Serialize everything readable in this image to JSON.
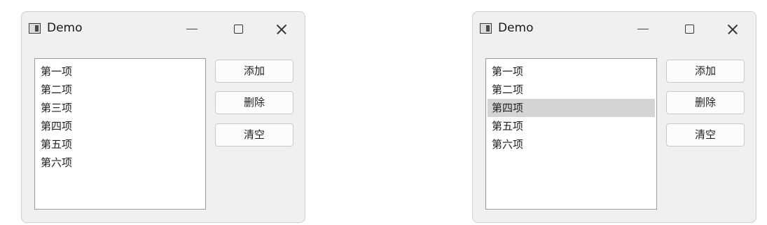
{
  "windows": [
    {
      "title": "Demo",
      "items": [
        "第一项",
        "第二项",
        "第三项",
        "第四项",
        "第五项",
        "第六项"
      ],
      "buttons": {
        "add": "添加",
        "delete": "删除",
        "clear": "清空"
      }
    },
    {
      "title": "Demo",
      "items": [
        "第一项",
        "第二项",
        "第四项",
        "第五项",
        "第六项"
      ],
      "selected_item": "第四项",
      "buttons": {
        "add": "添加",
        "delete": "删除",
        "clear": "清空"
      }
    }
  ]
}
